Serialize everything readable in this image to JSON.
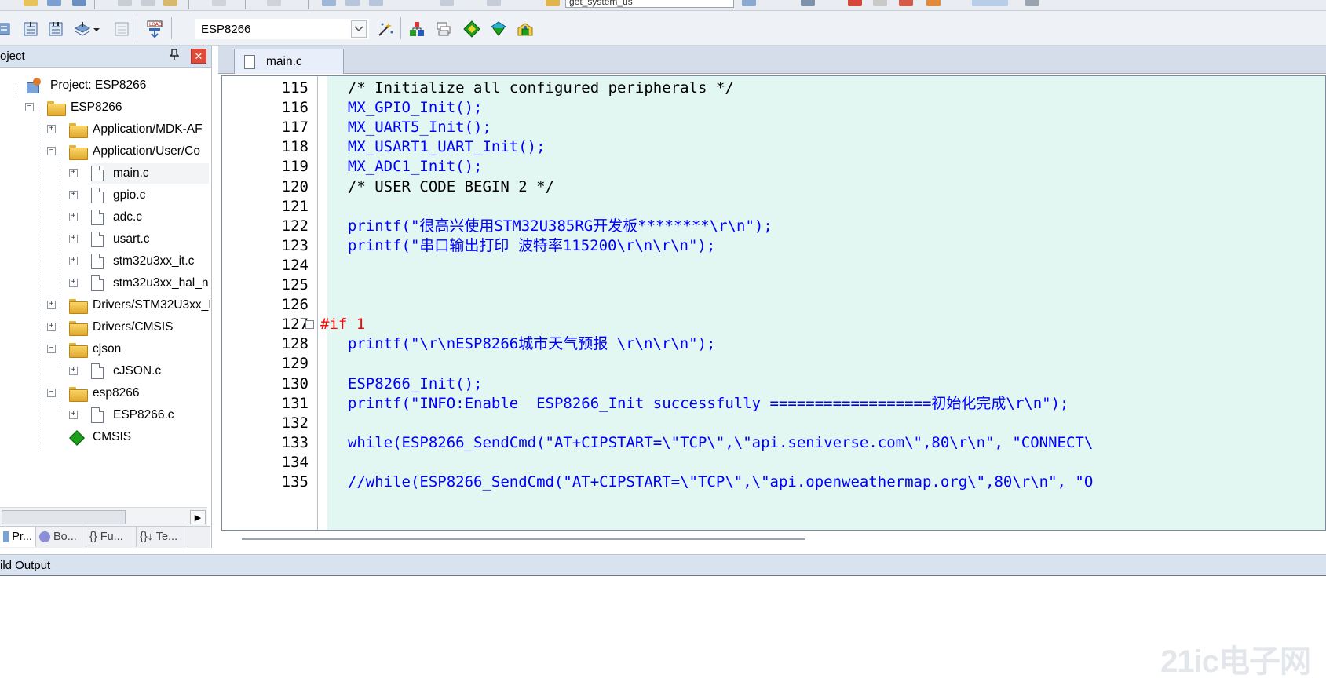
{
  "toolbar_top": {
    "target_func": "get_system_us"
  },
  "toolbar": {
    "target_name": "ESP8266",
    "buttons": [
      "translate-icon",
      "build-icon",
      "rebuild-icon",
      "batch-build-icon",
      "stop-build-icon",
      "download-icon",
      "target-options-icon",
      "manage-components-icon",
      "file-extensions-icon",
      "pack-installer-icon",
      "run-time-env-icon"
    ]
  },
  "project_panel": {
    "title": "oject",
    "pin_glyph": "ᵖ",
    "close_glyph": "x",
    "tree": [
      {
        "label": "Project: ESP8266",
        "icon": "project-icon"
      },
      {
        "label": "ESP8266",
        "icon": "target-icon"
      },
      {
        "label": "Application/MDK-AF",
        "icon": "folder-icon"
      },
      {
        "label": "Application/User/Co",
        "icon": "folder-open-icon"
      },
      {
        "label": "main.c",
        "icon": "file-icon"
      },
      {
        "label": "gpio.c",
        "icon": "file-icon"
      },
      {
        "label": "adc.c",
        "icon": "file-icon"
      },
      {
        "label": "usart.c",
        "icon": "file-icon"
      },
      {
        "label": "stm32u3xx_it.c",
        "icon": "file-icon"
      },
      {
        "label": "stm32u3xx_hal_n",
        "icon": "file-icon"
      },
      {
        "label": "Drivers/STM32U3xx_I",
        "icon": "folder-icon"
      },
      {
        "label": "Drivers/CMSIS",
        "icon": "folder-icon"
      },
      {
        "label": "cjson",
        "icon": "folder-open-icon"
      },
      {
        "label": "cJSON.c",
        "icon": "file-icon"
      },
      {
        "label": "esp8266",
        "icon": "folder-open-icon"
      },
      {
        "label": "ESP8266.c",
        "icon": "file-icon"
      },
      {
        "label": "CMSIS",
        "icon": "cmsis-icon"
      }
    ],
    "tabs": [
      "Pr...",
      "Bo...",
      "{} Fu...",
      "{}↓ Te..."
    ]
  },
  "editor": {
    "active_tab": "main.c",
    "lines": [
      {
        "n": "115",
        "code": "  /* Initialize all configured peripherals */",
        "kind": "cmt"
      },
      {
        "n": "116",
        "code": "  MX_GPIO_Init();",
        "kind": "fn"
      },
      {
        "n": "117",
        "code": "  MX_UART5_Init();",
        "kind": "fn"
      },
      {
        "n": "118",
        "code": "  MX_USART1_UART_Init();",
        "kind": "fn"
      },
      {
        "n": "119",
        "code": "  MX_ADC1_Init();",
        "kind": "fn"
      },
      {
        "n": "120",
        "code": "  /* USER CODE BEGIN 2 */",
        "kind": "cmt"
      },
      {
        "n": "121",
        "code": "",
        "kind": "fn"
      },
      {
        "n": "122",
        "code": "  printf(\"很高兴使用STM32U385RG开发板********\\r\\n\");",
        "kind": "fn"
      },
      {
        "n": "123",
        "code": "  printf(\"串口输出打印 波特率115200\\r\\n\\r\\n\");",
        "kind": "fn"
      },
      {
        "n": "124",
        "code": "",
        "kind": "fn"
      },
      {
        "n": "125",
        "code": "",
        "kind": "fn"
      },
      {
        "n": "126",
        "code": "",
        "kind": "fn"
      },
      {
        "n": "127",
        "code": "#if 1",
        "kind": "pre"
      },
      {
        "n": "128",
        "code": "  printf(\"\\r\\nESP8266城市天气预报 \\r\\n\\r\\n\");",
        "kind": "fn"
      },
      {
        "n": "129",
        "code": "",
        "kind": "fn"
      },
      {
        "n": "130",
        "code": "  ESP8266_Init();",
        "kind": "fn"
      },
      {
        "n": "131",
        "code": "  printf(\"INFO:Enable  ESP8266_Init successfully ==================初始化完成\\r\\n\");",
        "kind": "fn"
      },
      {
        "n": "132",
        "code": "",
        "kind": "fn"
      },
      {
        "n": "133",
        "code": "  while(ESP8266_SendCmd(\"AT+CIPSTART=\\\"TCP\\\",\\\"api.seniverse.com\\\",80\\r\\n\", \"CONNECT\\",
        "kind": "fn"
      },
      {
        "n": "134",
        "code": "",
        "kind": "fn"
      },
      {
        "n": "135",
        "code": "  //while(ESP8266_SendCmd(\"AT+CIPSTART=\\\"TCP\\\",\\\"api.openweathermap.org\\\",80\\r\\n\", \"O",
        "kind": "fn"
      }
    ]
  },
  "build_output": {
    "title": "ild Output"
  },
  "watermark": "21ic电子网",
  "colors": {
    "code_bg": "#e2f7f1",
    "keyword_blue": "#0000ff",
    "preproc_red": "#ff0000",
    "panel_title": "#d9e2ef"
  }
}
